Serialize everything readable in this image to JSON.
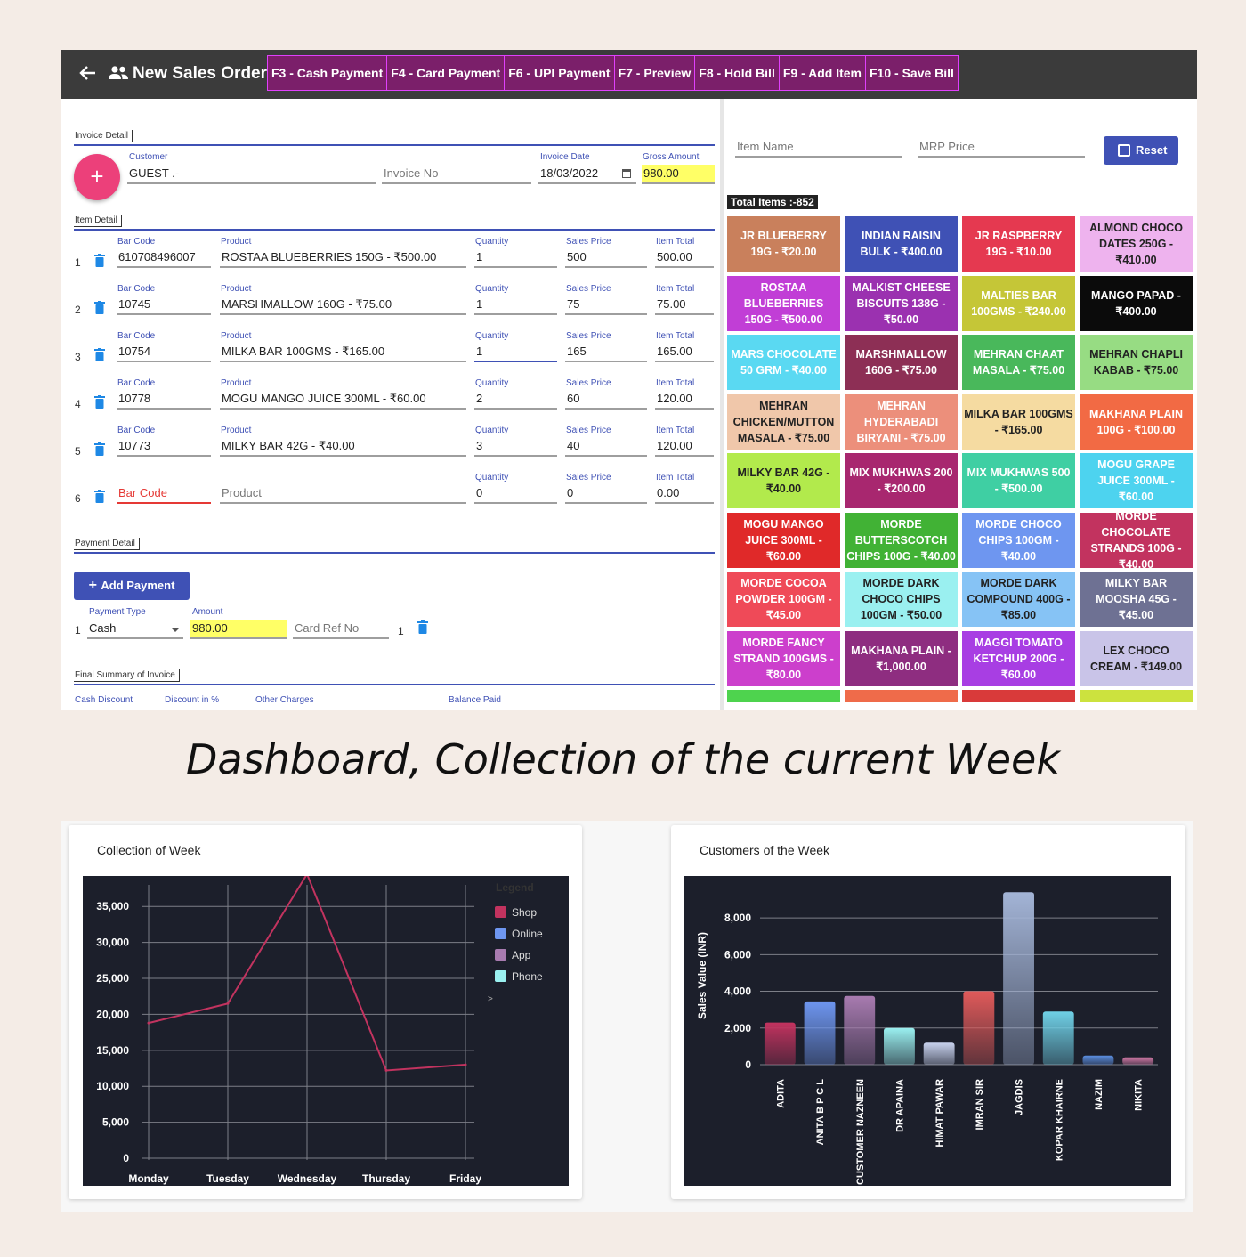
{
  "topbar": {
    "title": "New Sales Order",
    "shortcuts": [
      "F3 - Cash Payment",
      "F4 - Card Payment",
      "F6 - UPI Payment",
      "F7 - Preview",
      "F8 - Hold Bill",
      "F9 - Add Item",
      "F10 - Save Bill"
    ]
  },
  "invoice": {
    "section_label": "Invoice Detail",
    "customer_label": "Customer",
    "customer_value": "GUEST .-",
    "invoice_no_placeholder": "Invoice No",
    "date_label": "Invoice Date",
    "date_value": "18/03/2022",
    "gross_label": "Gross Amount",
    "gross_value": "980.00"
  },
  "items": {
    "section_label": "Item Detail",
    "labels": {
      "barcode": "Bar Code",
      "product": "Product",
      "quantity": "Quantity",
      "price": "Sales Price",
      "total": "Item Total"
    },
    "rows": [
      {
        "num": "1",
        "barcode": "610708496007",
        "product": "ROSTAA BLUEBERRIES 150G   - ₹500.00",
        "quantity": "1",
        "price": "500",
        "total": "500.00"
      },
      {
        "num": "2",
        "barcode": "10745",
        "product": "MARSHMALLOW 160G   - ₹75.00",
        "quantity": "1",
        "price": "75",
        "total": "75.00"
      },
      {
        "num": "3",
        "barcode": "10754",
        "product": "MILKA BAR 100GMS   - ₹165.00",
        "quantity": "1",
        "price": "165",
        "total": "165.00"
      },
      {
        "num": "4",
        "barcode": "10778",
        "product": "MOGU MANGO JUICE 300ML   - ₹60.00",
        "quantity": "2",
        "price": "60",
        "total": "120.00"
      },
      {
        "num": "5",
        "barcode": "10773",
        "product": "MILKY BAR 42G   - ₹40.00",
        "quantity": "3",
        "price": "40",
        "total": "120.00"
      }
    ],
    "new_row": {
      "num": "6",
      "barcode_placeholder": "Bar Code",
      "product_placeholder": "Product",
      "quantity": "0",
      "price": "0",
      "total": "0.00"
    }
  },
  "payment": {
    "section_label": "Payment Detail",
    "add_button": "Add Payment",
    "type_label": "Payment Type",
    "type_value": "Cash",
    "amount_label": "Amount",
    "amount_value": "980.00",
    "card_ref_placeholder": "Card Ref No",
    "row_num": "1",
    "count": "1"
  },
  "summary": {
    "section_label": "Final Summary of Invoice",
    "labels": [
      "Cash Discount",
      "Discount in %",
      "Other Charges",
      "Balance Paid"
    ]
  },
  "catalog": {
    "item_name_placeholder": "Item Name",
    "mrp_placeholder": "MRP Price",
    "reset_label": "Reset",
    "total_items": "Total Items :-852",
    "tiles": [
      {
        "label": "JR BLUEBERRY 19G - ₹20.00",
        "bg": "#c9805c",
        "fg": "#ffffff"
      },
      {
        "label": "INDIAN RAISIN BULK - ₹400.00",
        "bg": "#3f51b5",
        "fg": "#ffffff"
      },
      {
        "label": "JR RASPBERRY 19G - ₹10.00",
        "bg": "#e53950",
        "fg": "#ffffff"
      },
      {
        "label": "ALMOND CHOCO DATES 250G - ₹410.00",
        "bg": "#eeb3ee",
        "fg": "#222222"
      },
      {
        "label": "ROSTAA BLUEBERRIES 150G - ₹500.00",
        "bg": "#c13ed6",
        "fg": "#ffffff"
      },
      {
        "label": "MALKIST CHEESE BISCUITS 138G - ₹50.00",
        "bg": "#9b31b0",
        "fg": "#ffffff"
      },
      {
        "label": "MALTIES BAR 100GMS - ₹240.00",
        "bg": "#c5c637",
        "fg": "#ffffff"
      },
      {
        "label": "MANGO PAPAD - ₹400.00",
        "bg": "#0b0b0b",
        "fg": "#ffffff"
      },
      {
        "label": "MARS CHOCOLATE 50 GRM - ₹40.00",
        "bg": "#5ad9f2",
        "fg": "#ffffff"
      },
      {
        "label": "MARSHMALLOW 160G - ₹75.00",
        "bg": "#8d2f55",
        "fg": "#ffffff"
      },
      {
        "label": "MEHRAN CHAAT MASALA - ₹75.00",
        "bg": "#49b85b",
        "fg": "#ffffff"
      },
      {
        "label": "MEHRAN CHAPLI KABAB - ₹75.00",
        "bg": "#97dc83",
        "fg": "#222222"
      },
      {
        "label": "MEHRAN CHICKEN/MUTTON MASALA - ₹75.00",
        "bg": "#f0c7aa",
        "fg": "#222222"
      },
      {
        "label": "MEHRAN HYDERABADI BIRYANI - ₹75.00",
        "bg": "#ec8f7b",
        "fg": "#ffffff"
      },
      {
        "label": "MILKA BAR 100GMS - ₹165.00",
        "bg": "#f5dba1",
        "fg": "#222222"
      },
      {
        "label": "MAKHANA PLAIN 100G - ₹100.00",
        "bg": "#f26a44",
        "fg": "#ffffff"
      },
      {
        "label": "MILKY BAR 42G - ₹40.00",
        "bg": "#b2ea4c",
        "fg": "#222222"
      },
      {
        "label": "MIX MUKHWAS 200 - ₹200.00",
        "bg": "#a8276f",
        "fg": "#ffffff"
      },
      {
        "label": "MIX MUKHWAS 500 - ₹500.00",
        "bg": "#3fcfa3",
        "fg": "#ffffff"
      },
      {
        "label": "MOGU GRAPE JUICE 300ML - ₹60.00",
        "bg": "#4dd3ef",
        "fg": "#ffffff"
      },
      {
        "label": "MOGU MANGO JUICE 300ML - ₹60.00",
        "bg": "#e02929",
        "fg": "#ffffff"
      },
      {
        "label": "MORDE BUTTERSCOTCH CHIPS 100G - ₹40.00",
        "bg": "#41b235",
        "fg": "#ffffff"
      },
      {
        "label": "MORDE CHOCO CHIPS 100GM - ₹40.00",
        "bg": "#6e96f0",
        "fg": "#ffffff"
      },
      {
        "label": "MORDE CHOCOLATE STRANDS 100G - ₹40.00",
        "bg": "#c2335f",
        "fg": "#ffffff"
      },
      {
        "label": "MORDE COCOA POWDER 100GM - ₹45.00",
        "bg": "#ef4a58",
        "fg": "#ffffff"
      },
      {
        "label": "MORDE DARK CHOCO CHIPS 100GM - ₹50.00",
        "bg": "#9af0f0",
        "fg": "#222222"
      },
      {
        "label": "MORDE DARK COMPOUND 400G - ₹85.00",
        "bg": "#86c3f5",
        "fg": "#222222"
      },
      {
        "label": "MILKY BAR MOOSHA 45G - ₹45.00",
        "bg": "#6e7193",
        "fg": "#ffffff"
      },
      {
        "label": "MORDE FANCY STRAND 100GMS - ₹80.00",
        "bg": "#cc3fcc",
        "fg": "#ffffff"
      },
      {
        "label": "MAKHANA PLAIN - ₹1,000.00",
        "bg": "#8e2d80",
        "fg": "#ffffff"
      },
      {
        "label": "MAGGI TOMATO KETCHUP 200G - ₹60.00",
        "bg": "#a83ee3",
        "fg": "#ffffff"
      },
      {
        "label": "LEX CHOCO CREAM - ₹149.00",
        "bg": "#c9c4e8",
        "fg": "#222222"
      },
      {
        "label": "",
        "bg": "#4ed34e",
        "fg": "#ffffff"
      },
      {
        "label": "",
        "bg": "#ef6b4a",
        "fg": "#ffffff"
      },
      {
        "label": "",
        "bg": "#d93a3a",
        "fg": "#ffffff"
      },
      {
        "label": "",
        "bg": "#cce23e",
        "fg": "#ffffff"
      }
    ]
  },
  "caption": "Dashboard, Collection of the current Week",
  "cards": {
    "collection_title": "Collection of Week",
    "customers_title": "Customers of the Week"
  },
  "chart_data": [
    {
      "type": "line",
      "title": "Collection of Week",
      "categories": [
        "Monday",
        "Tuesday",
        "Wednesday",
        "Thursday",
        "Friday"
      ],
      "yticks": [
        "0",
        "5,000",
        "10,000",
        "15,000",
        "20,000",
        "25,000",
        "30,000",
        "35,000"
      ],
      "ylim": [
        0,
        38000
      ],
      "series": [
        {
          "name": "Shop",
          "values": [
            18800,
            21500,
            39500,
            12200,
            13000
          ],
          "color": "#c2335f"
        }
      ],
      "legend": {
        "title": "Legend",
        "placement": "top-right",
        "entries": [
          {
            "name": "Shop",
            "color": "#c2335f"
          },
          {
            "name": "Online",
            "color": "#6e96f0"
          },
          {
            "name": "App",
            "color": "#a87bb0"
          },
          {
            "name": "Phone",
            "color": "#9af0f0"
          }
        ],
        "more": ">"
      },
      "grid": true
    },
    {
      "type": "bar",
      "title": "Customers of the Week",
      "ylabel": "Sales Value (INR)",
      "yticks": [
        "0",
        "2,000",
        "4,000",
        "6,000",
        "8,000"
      ],
      "ylim": [
        0,
        9800
      ],
      "categories": [
        "ADITA",
        "ANITA B P C L",
        "CUSTOMER NAZNEEN",
        "DR APAINA",
        "HIMAT PAWAR",
        "IMRAN SIR",
        "JAGDIS",
        "KOPAR KHAIRNE",
        "NAZIM",
        "NIKITA"
      ],
      "values": [
        2300,
        3450,
        3750,
        2000,
        1200,
        4000,
        9400,
        2900,
        500,
        400
      ],
      "colors": [
        "#c2335f",
        "#6e96f0",
        "#a87bb0",
        "#9af0f0",
        "#c9d3ef",
        "#e05a5a",
        "#a3b4d6",
        "#6fd0e6",
        "#5b8ee0",
        "#d47aa8"
      ],
      "grid": true
    }
  ]
}
